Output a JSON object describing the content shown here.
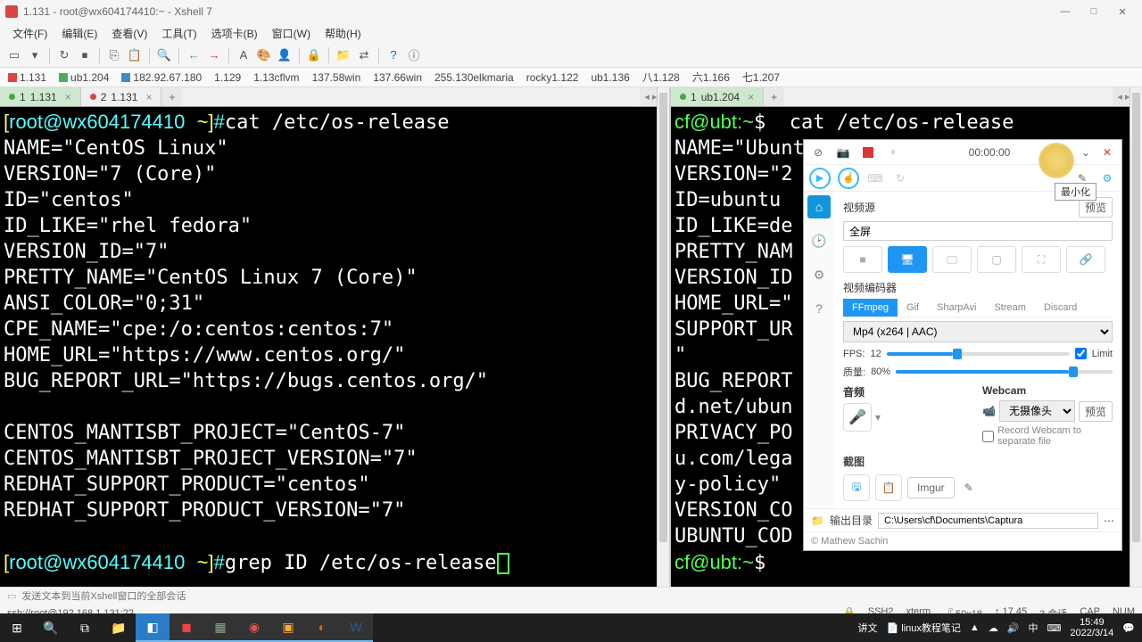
{
  "window": {
    "title": "1.131 - root@wx604174410:~ - Xshell 7",
    "min": "—",
    "max": "□",
    "close": "✕"
  },
  "menu": [
    "文件(F)",
    "编辑(E)",
    "查看(V)",
    "工具(T)",
    "选项卡(B)",
    "窗口(W)",
    "帮助(H)"
  ],
  "sessions": [
    {
      "icon": "red",
      "label": "1.131"
    },
    {
      "icon": "green",
      "label": "ub1.204"
    },
    {
      "icon": "blue",
      "label": "182.92.67.180"
    },
    {
      "icon": "",
      "label": "1.129"
    },
    {
      "icon": "",
      "label": "1.13cflvm"
    },
    {
      "icon": "",
      "label": "137.58win"
    },
    {
      "icon": "",
      "label": "137.66win"
    },
    {
      "icon": "",
      "label": "255.130elkmaria"
    },
    {
      "icon": "",
      "label": "rocky1.122"
    },
    {
      "icon": "",
      "label": "ub1.136"
    },
    {
      "icon": "",
      "label": "八1.128"
    },
    {
      "icon": "",
      "label": "六1.166"
    },
    {
      "icon": "",
      "label": "七1.207"
    }
  ],
  "left_tabs": [
    {
      "num": "1",
      "dot": "g",
      "label": "1.131",
      "active": true
    },
    {
      "num": "2",
      "dot": "r",
      "label": "1.131",
      "active": false
    }
  ],
  "right_tabs": [
    {
      "num": "1",
      "dot": "g",
      "label": "ub1.204",
      "active": true
    }
  ],
  "term_left": {
    "prompt_user": "root@wx604174410",
    "prompt_path": "~",
    "cmd1": "cat /etc/os-release",
    "lines": [
      "NAME=\"CentOS Linux\"",
      "VERSION=\"7 (Core)\"",
      "ID=\"centos\"",
      "ID_LIKE=\"rhel fedora\"",
      "VERSION_ID=\"7\"",
      "PRETTY_NAME=\"CentOS Linux 7 (Core)\"",
      "ANSI_COLOR=\"0;31\"",
      "CPE_NAME=\"cpe:/o:centos:centos:7\"",
      "HOME_URL=\"https://www.centos.org/\"",
      "BUG_REPORT_URL=\"https://bugs.centos.org/\"",
      "",
      "CENTOS_MANTISBT_PROJECT=\"CentOS-7\"",
      "CENTOS_MANTISBT_PROJECT_VERSION=\"7\"",
      "REDHAT_SUPPORT_PRODUCT=\"centos\"",
      "REDHAT_SUPPORT_PRODUCT_VERSION=\"7\""
    ],
    "cmd2": "grep ID /etc/os-release"
  },
  "term_right": {
    "prompt": "cf@ubt:~$ ",
    "cmd1": "cat /etc/os-release",
    "lines": [
      "NAME=\"Ubuntu\"",
      "VERSION=\"2",
      "ID=ubuntu",
      "ID_LIKE=de",
      "PRETTY_NAM",
      "VERSION_ID",
      "HOME_URL=\"",
      "SUPPORT_UR",
      "\"",
      "BUG_REPORT",
      "d.net/ubun",
      "PRIVACY_PO",
      "u.com/lega",
      "y-policy\"",
      "VERSION_CO",
      "UBUNTU_COD"
    ],
    "prompt2": "cf@ubt:~$ "
  },
  "captura": {
    "timer": "00:00:00",
    "minimize": "最小化",
    "section_video": "视频源",
    "preview": "预览",
    "fullscreen": "全屏",
    "section_encoder": "视频编码器",
    "enc_tabs": [
      "FFmpeg",
      "Gif",
      "SharpAvi",
      "Stream",
      "Discard"
    ],
    "codec": "Mp4 (x264 | AAC)",
    "fps_label": "FPS:",
    "fps_val": "12",
    "limit": "Limit",
    "quality_label": "质量:",
    "quality_val": "80%",
    "audio": "音频",
    "webcam": "Webcam",
    "cam_none": "无摄像头",
    "rec_webcam": "Record Webcam to separate file",
    "screenshot": "截图",
    "imgur": "Imgur",
    "out_label": "输出目录",
    "out_path": "C:\\Users\\cf\\Documents\\Captura",
    "credit": "© Mathew Sachin"
  },
  "compose_placeholder": "发送文本到当前Xshell窗口的全部会话",
  "status": {
    "left": "ssh://root@192.168.1.131:22",
    "ssh": "SSH2",
    "term": "xterm",
    "size": "50x18",
    "pos": "17,45",
    "sess": "3 会话",
    "cap": "CAP",
    "num": "NUM"
  },
  "tasktray": {
    "items": [
      "讲文",
      "linux教程笔记",
      "▲",
      "☁",
      "🔊",
      "中",
      "⌨"
    ],
    "time": "15:49",
    "date": "2022/3/14"
  }
}
